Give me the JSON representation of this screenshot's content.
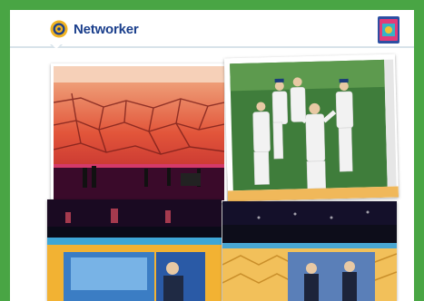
{
  "header": {
    "title": "Networker",
    "logo_icon": "rotary-wheel-icon",
    "badge_icon": "app-badge-icon"
  },
  "colors": {
    "frame": "#49a544",
    "title": "#1b3f8c",
    "header_line": "#d8e3ea"
  },
  "photos": [
    {
      "subject": "stage-desert-backdrop"
    },
    {
      "subject": "cricket-team-celebration"
    },
    {
      "subject": "stage-blue-screen-speaker"
    },
    {
      "subject": "stage-speakers-screen"
    }
  ]
}
